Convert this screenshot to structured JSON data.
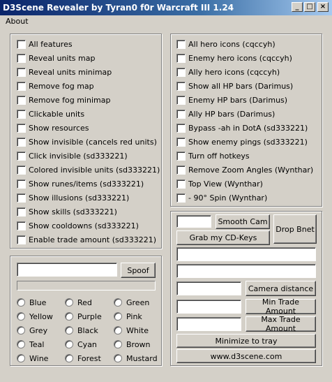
{
  "window": {
    "title": "D3Scene Revealer by Tyran0 f0r Warcraft III 1.24"
  },
  "menu": {
    "about": "About"
  },
  "left_options": [
    "All features",
    "Reveal units map",
    "Reveal units minimap",
    "Remove fog map",
    "Remove fog minimap",
    "Clickable units",
    "Show resources",
    "Show invisible (cancels red units)",
    "Click invisible (sd333221)",
    "Colored invisible units (sd333221)",
    "Show runes/items (sd333221)",
    "Show illusions (sd333221)",
    "Show skills (sd333221)",
    "Show cooldowns (sd333221)",
    "Enable trade amount (sd333221)"
  ],
  "right_options": [
    "All hero icons (cqccyh)",
    "Enemy hero icons (cqccyh)",
    "Ally hero icons (cqccyh)",
    "Show all HP bars (Darimus)",
    "Enemy HP bars (Darimus)",
    "Ally HP bars (Darimus)",
    "Bypass -ah in DotA (sd333221)",
    "Show enemy pings (sd333221)",
    "Turn off hotkeys",
    "Remove Zoom Angles (Wynthar)",
    "Top View (Wynthar)",
    "- 90° Spin (Wynthar)"
  ],
  "spoof": {
    "button": "Spoof",
    "value": ""
  },
  "colors": [
    "Blue",
    "Red",
    "Green",
    "Yellow",
    "Purple",
    "Pink",
    "Grey",
    "Black",
    "White",
    "Teal",
    "Cyan",
    "Brown",
    "Wine",
    "Forest",
    "Mustard"
  ],
  "controls": {
    "smooth_cam": "Smooth Cam",
    "drop_bnet": "Drop Bnet",
    "grab_keys": "Grab my CD-Keys",
    "camera_distance": "Camera distance",
    "min_trade": "Min Trade Amount",
    "max_trade": "Max Trade Amount",
    "minimize": "Minimize to tray",
    "website": "www.d3scene.com"
  }
}
